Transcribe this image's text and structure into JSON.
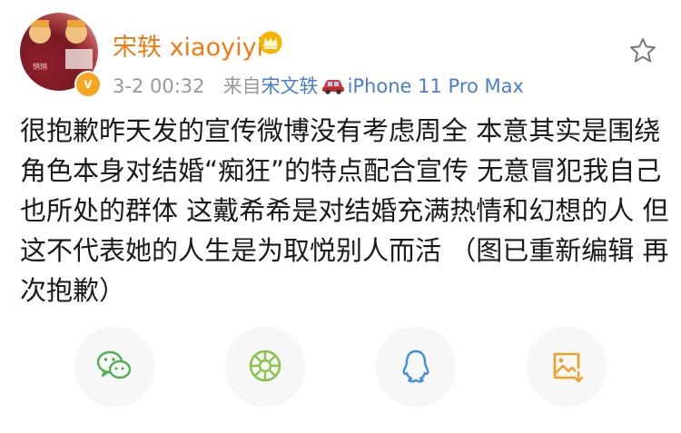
{
  "post": {
    "author": "宋轶 xiaoyiyi",
    "time": "3-2 00:32",
    "source_prefix": "来自",
    "source_name": "宋文轶",
    "device": "iPhone 11 Pro Max",
    "text": "很抱歉昨天发的宣传微博没有考虑周全 本意其实是围绕角色本身对结婚“痴狂”的特点配合宣传 无意冒犯我自己也所处的群体 这戴希希是对结婚充满热情和幻想的人 但这不代表她的人生是为取悦别人而活 （图已重新编辑 再次抱歉）",
    "verified_badge": "v"
  },
  "icons": {
    "avatar": "avatar-image",
    "vip": "crown-icon",
    "car": "car-emoji-icon",
    "favorite": "star-icon"
  },
  "share": [
    {
      "name": "wechat-icon",
      "color": "#4caf50"
    },
    {
      "name": "moments-icon",
      "color": "#8bc34a"
    },
    {
      "name": "qq-icon",
      "color": "#3d8fe0"
    },
    {
      "name": "save-image-icon",
      "color": "#f0a020"
    }
  ],
  "colors": {
    "username": "#f07b14",
    "link": "#4a7ec8",
    "meta": "#999999",
    "text": "#1a1a1a"
  }
}
